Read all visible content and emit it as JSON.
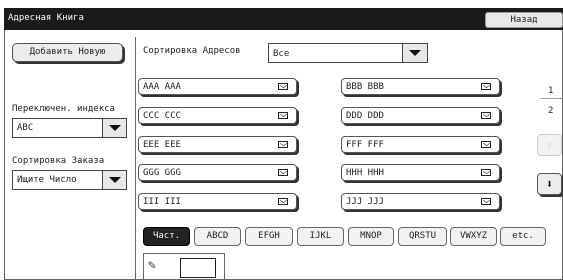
{
  "window": {
    "title": "Адресная Книга",
    "back_label": "Назад"
  },
  "sidebar": {
    "add_new_label": "Добавить Новую",
    "index_switch_label": "Переключен. индекса",
    "index_value": "ABC",
    "order_sort_label": "Сортировка Заказа",
    "order_value": "Ищите Число"
  },
  "sort": {
    "label": "Сортировка Адресов",
    "value": "Все"
  },
  "entries": [
    {
      "name": "AAA AAA"
    },
    {
      "name": "BBB BBB"
    },
    {
      "name": "CCC CCC"
    },
    {
      "name": "DDD DDD"
    },
    {
      "name": "EEE EEE"
    },
    {
      "name": "FFF FFF"
    },
    {
      "name": "GGG GGG"
    },
    {
      "name": "HHH HHH"
    },
    {
      "name": "III III"
    },
    {
      "name": "JJJ JJJ"
    }
  ],
  "pagination": {
    "page_1": "1",
    "page_2": "2"
  },
  "tabs": [
    {
      "label": "Част.",
      "active": true
    },
    {
      "label": "ABCD"
    },
    {
      "label": "EFGH"
    },
    {
      "label": "IJKL"
    },
    {
      "label": "MNOP"
    },
    {
      "label": "QRSTU"
    },
    {
      "label": "VWXYZ"
    },
    {
      "label": "etc."
    }
  ],
  "number_search": {
    "value": ""
  }
}
